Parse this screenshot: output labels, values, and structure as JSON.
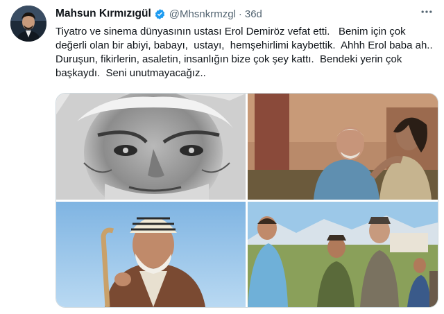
{
  "tweet": {
    "author_name": "Mahsun Kırmızıgül",
    "handle": "@Mhsnkrmzgl",
    "separator": "·",
    "time": "36d",
    "text": "Tiyatro ve sinema dünyasının ustası Erol Demiröz vefat etti.   Benim için çok değerli olan bir abiyi, babayı,  ustayı,  hemşehirlimi kaybettik.  Ahhh Erol baba ah..  Duruşun, fikirlerin, asaletin, insanlığın bize çok şey kattı.  Bendeki yerin çok başkaydı.  Seni unutmayacağız..",
    "more_icon": "more-horizontal-icon",
    "verified_icon": "verified-badge-icon"
  },
  "colors": {
    "text": "#0f1419",
    "secondary": "#536471",
    "verified": "#1d9bf0",
    "border": "#cfd9de"
  }
}
